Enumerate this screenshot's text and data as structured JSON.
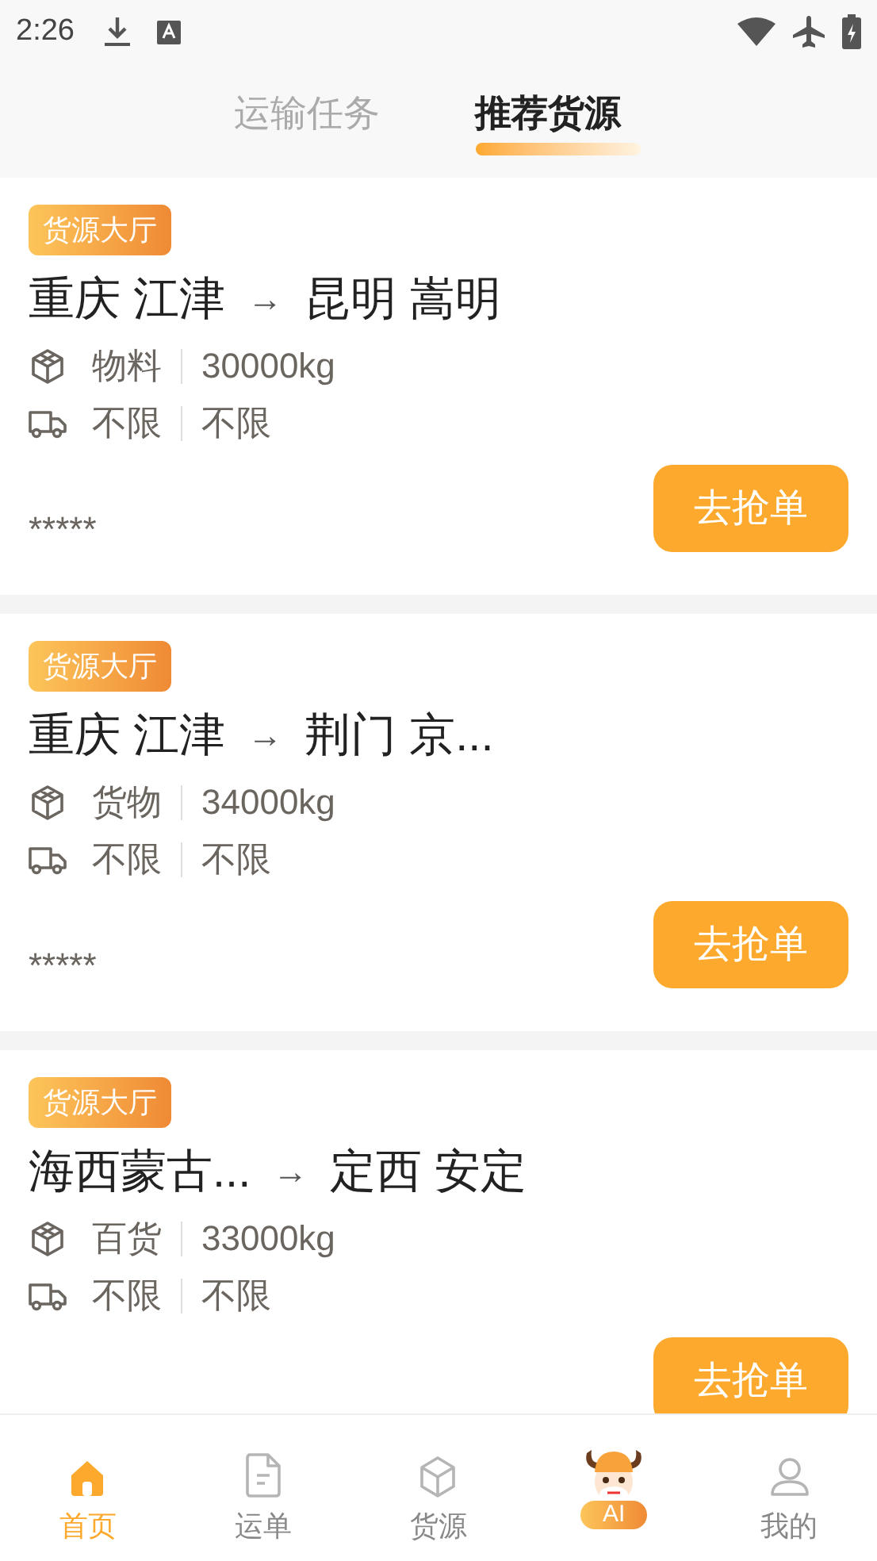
{
  "status_bar": {
    "time": "2:26"
  },
  "tabs": [
    {
      "label": "运输任务",
      "selected": false
    },
    {
      "label": "推荐货源",
      "selected": true
    }
  ],
  "cards": [
    {
      "tag": "货源大厅",
      "origin": "重庆 江津",
      "arrow": "→",
      "destination": "昆明 嵩明",
      "cargo": "物料",
      "weight": "30000kg",
      "vehicle_length": "不限",
      "vehicle_type": "不限",
      "contact": "*****",
      "button": "去抢单"
    },
    {
      "tag": "货源大厅",
      "origin": "重庆 江津",
      "arrow": "→",
      "destination": "荆门 京...",
      "cargo": "货物",
      "weight": "34000kg",
      "vehicle_length": "不限",
      "vehicle_type": "不限",
      "contact": "*****",
      "button": "去抢单"
    },
    {
      "tag": "货源大厅",
      "origin": "海西蒙古...",
      "arrow": "→",
      "destination": "定西 安定",
      "cargo": "百货",
      "weight": "33000kg",
      "vehicle_length": "不限",
      "vehicle_type": "不限",
      "button": "去抢单"
    }
  ],
  "bottom_nav": [
    {
      "kind": "home",
      "label": "首页",
      "selected": true
    },
    {
      "kind": "document",
      "label": "运单",
      "selected": false
    },
    {
      "kind": "box",
      "label": "货源",
      "selected": false
    },
    {
      "kind": "mascot",
      "label": "AI",
      "selected": false
    },
    {
      "kind": "person",
      "label": "我的",
      "selected": false
    }
  ]
}
